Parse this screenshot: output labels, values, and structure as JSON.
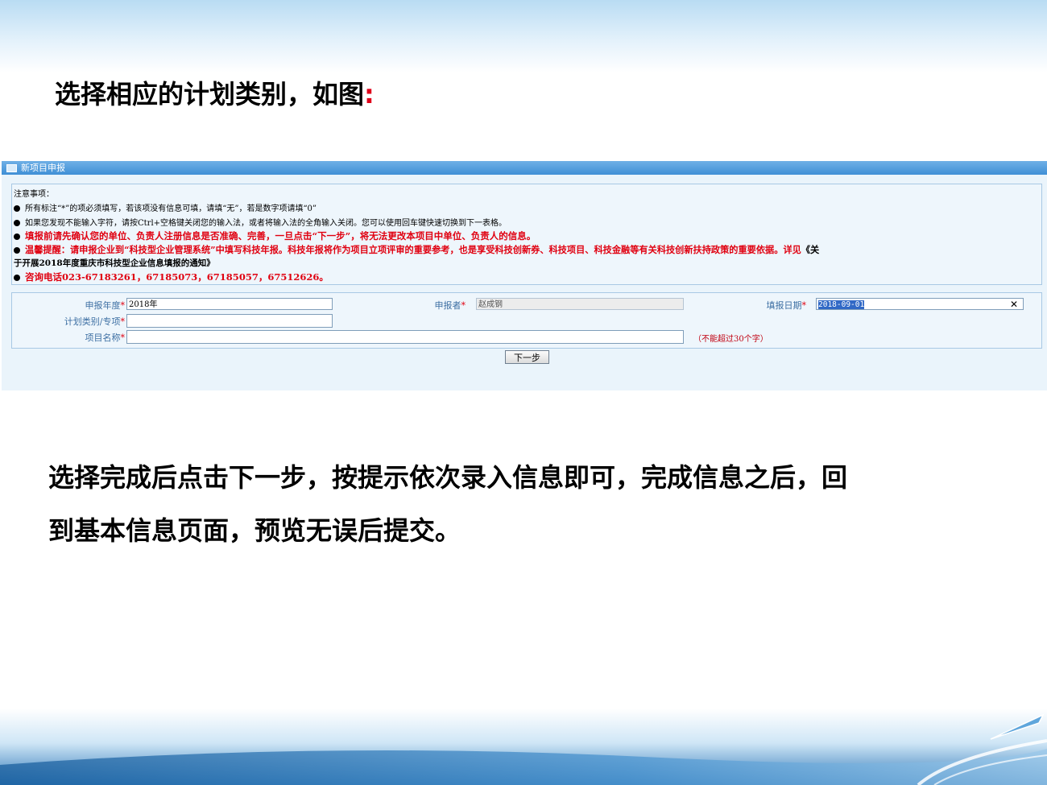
{
  "slide": {
    "title": "选择相应的计划类别，如图",
    "title_colon": ":",
    "body_line1": "选择完成后点击下一步，按提示依次录入信息即可，完成信息之后，回",
    "body_line2": "到基本信息页面，预览无误后提交。"
  },
  "window": {
    "title": "新项目申报"
  },
  "notice": {
    "heading": "注意事项：",
    "line1": "所有标注“*”的项必须填写，若该项没有信息可填，请填“无”，若是数字项请填“0”",
    "line2": "如果您发现不能输入字符，请按Ctrl+空格键关闭您的输入法，或者将输入法的全角输入关闭。您可以使用回车键快速切换到下一表格。",
    "line3": "填报前请先确认您的单位、负责人注册信息是否准确、完善，一旦点击“下一步”，将无法更改本项目中单位、负责人的信息。",
    "line4_red": "温馨提醒：请申报企业到“科技型企业管理系统”中填写科技年报。科技年报将作为项目立项评审的重要参考，也是享受科技创新券、科技项目、科技金融等有关科技创新扶持政策的重要依据。详见",
    "line4_black": "《关",
    "line5_black": "于开展2018年度重庆市科技型企业信息填报的通知》",
    "line6": "咨询电话023-67183261，67185073，67185057，67512626。"
  },
  "form": {
    "year_label": "申报年度",
    "year_value": "2018年",
    "applicant_label": "申报者",
    "applicant_value": "赵成钢",
    "date_label": "填报日期",
    "date_value": "2018-09-01",
    "plan_label": "计划类别/专项",
    "plan_value": "",
    "project_label": "项目名称",
    "project_value": "",
    "project_hint": "（不能超过30个字）",
    "required_mark": "*",
    "clear_glyph": "✕"
  },
  "next_button": "下一步",
  "colors": {
    "accent_red": "#e00010",
    "label_blue": "#3d6fa3",
    "header_blue": "#3f8fd6"
  }
}
